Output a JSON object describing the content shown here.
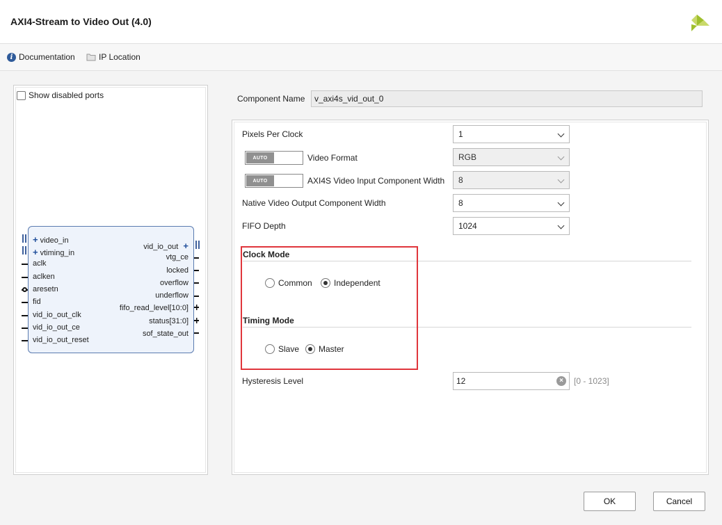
{
  "window": {
    "title": "AXI4-Stream to Video Out (4.0)"
  },
  "toolbar": {
    "documentation_label": "Documentation",
    "ip_location_label": "IP Location"
  },
  "left_panel": {
    "show_disabled_ports_label": "Show disabled ports",
    "left_ports": [
      "video_in",
      "vtiming_in",
      "aclk",
      "aclken",
      "aresetn",
      "fid",
      "vid_io_out_clk",
      "vid_io_out_ce",
      "vid_io_out_reset"
    ],
    "right_ports": [
      "vid_io_out",
      "vtg_ce",
      "locked",
      "overflow",
      "underflow",
      "fifo_read_level[10:0]",
      "status[31:0]",
      "sof_state_out"
    ]
  },
  "component": {
    "label": "Component Name",
    "value": "v_axi4s_vid_out_0"
  },
  "params": {
    "pixels_per_clock": {
      "label": "Pixels Per Clock",
      "value": "1"
    },
    "video_format": {
      "label": "Video Format",
      "value": "RGB",
      "toggle": "AUTO"
    },
    "axi4s_width": {
      "label": "AXI4S Video Input Component Width",
      "value": "8",
      "toggle": "AUTO"
    },
    "native_width": {
      "label": "Native Video Output Component Width",
      "value": "8"
    },
    "fifo_depth": {
      "label": "FIFO Depth",
      "value": "1024"
    }
  },
  "clock_mode": {
    "title": "Clock Mode",
    "options": [
      "Common",
      "Independent"
    ],
    "selected": "Independent"
  },
  "timing_mode": {
    "title": "Timing Mode",
    "options": [
      "Slave",
      "Master"
    ],
    "selected": "Master"
  },
  "hysteresis": {
    "label": "Hysteresis Level",
    "value": "12",
    "range": "[0 - 1023]"
  },
  "buttons": {
    "ok": "OK",
    "cancel": "Cancel"
  },
  "colors": {
    "highlight_border": "#e0353b",
    "logo": "#9fbf2d",
    "info_icon": "#2f5b9a"
  }
}
